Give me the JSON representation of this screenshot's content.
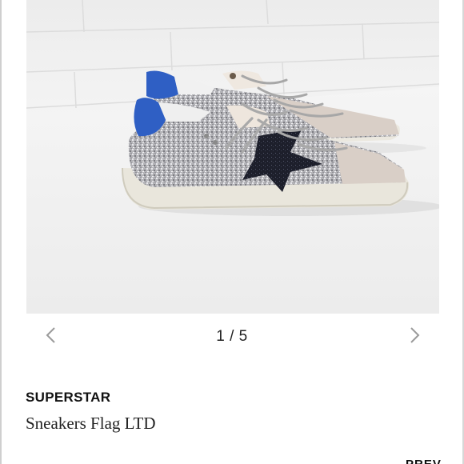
{
  "carousel": {
    "current": 1,
    "total": 5,
    "counter_text": "1 / 5",
    "prev_icon": "chevron-left-icon",
    "next_icon": "chevron-right-icon"
  },
  "product": {
    "brand": "SUPERSTAR",
    "name": "Sneakers Flag LTD",
    "image": "silver-glitter-sneakers-photo"
  },
  "footer": {
    "link_label": "PREV"
  },
  "colors": {
    "glitter": "#b9b9bd",
    "heel_tab": "#2f5fc4",
    "star": "#1c1e2a",
    "suede": "#d9cfc7",
    "sole": "#e9e6dc"
  }
}
